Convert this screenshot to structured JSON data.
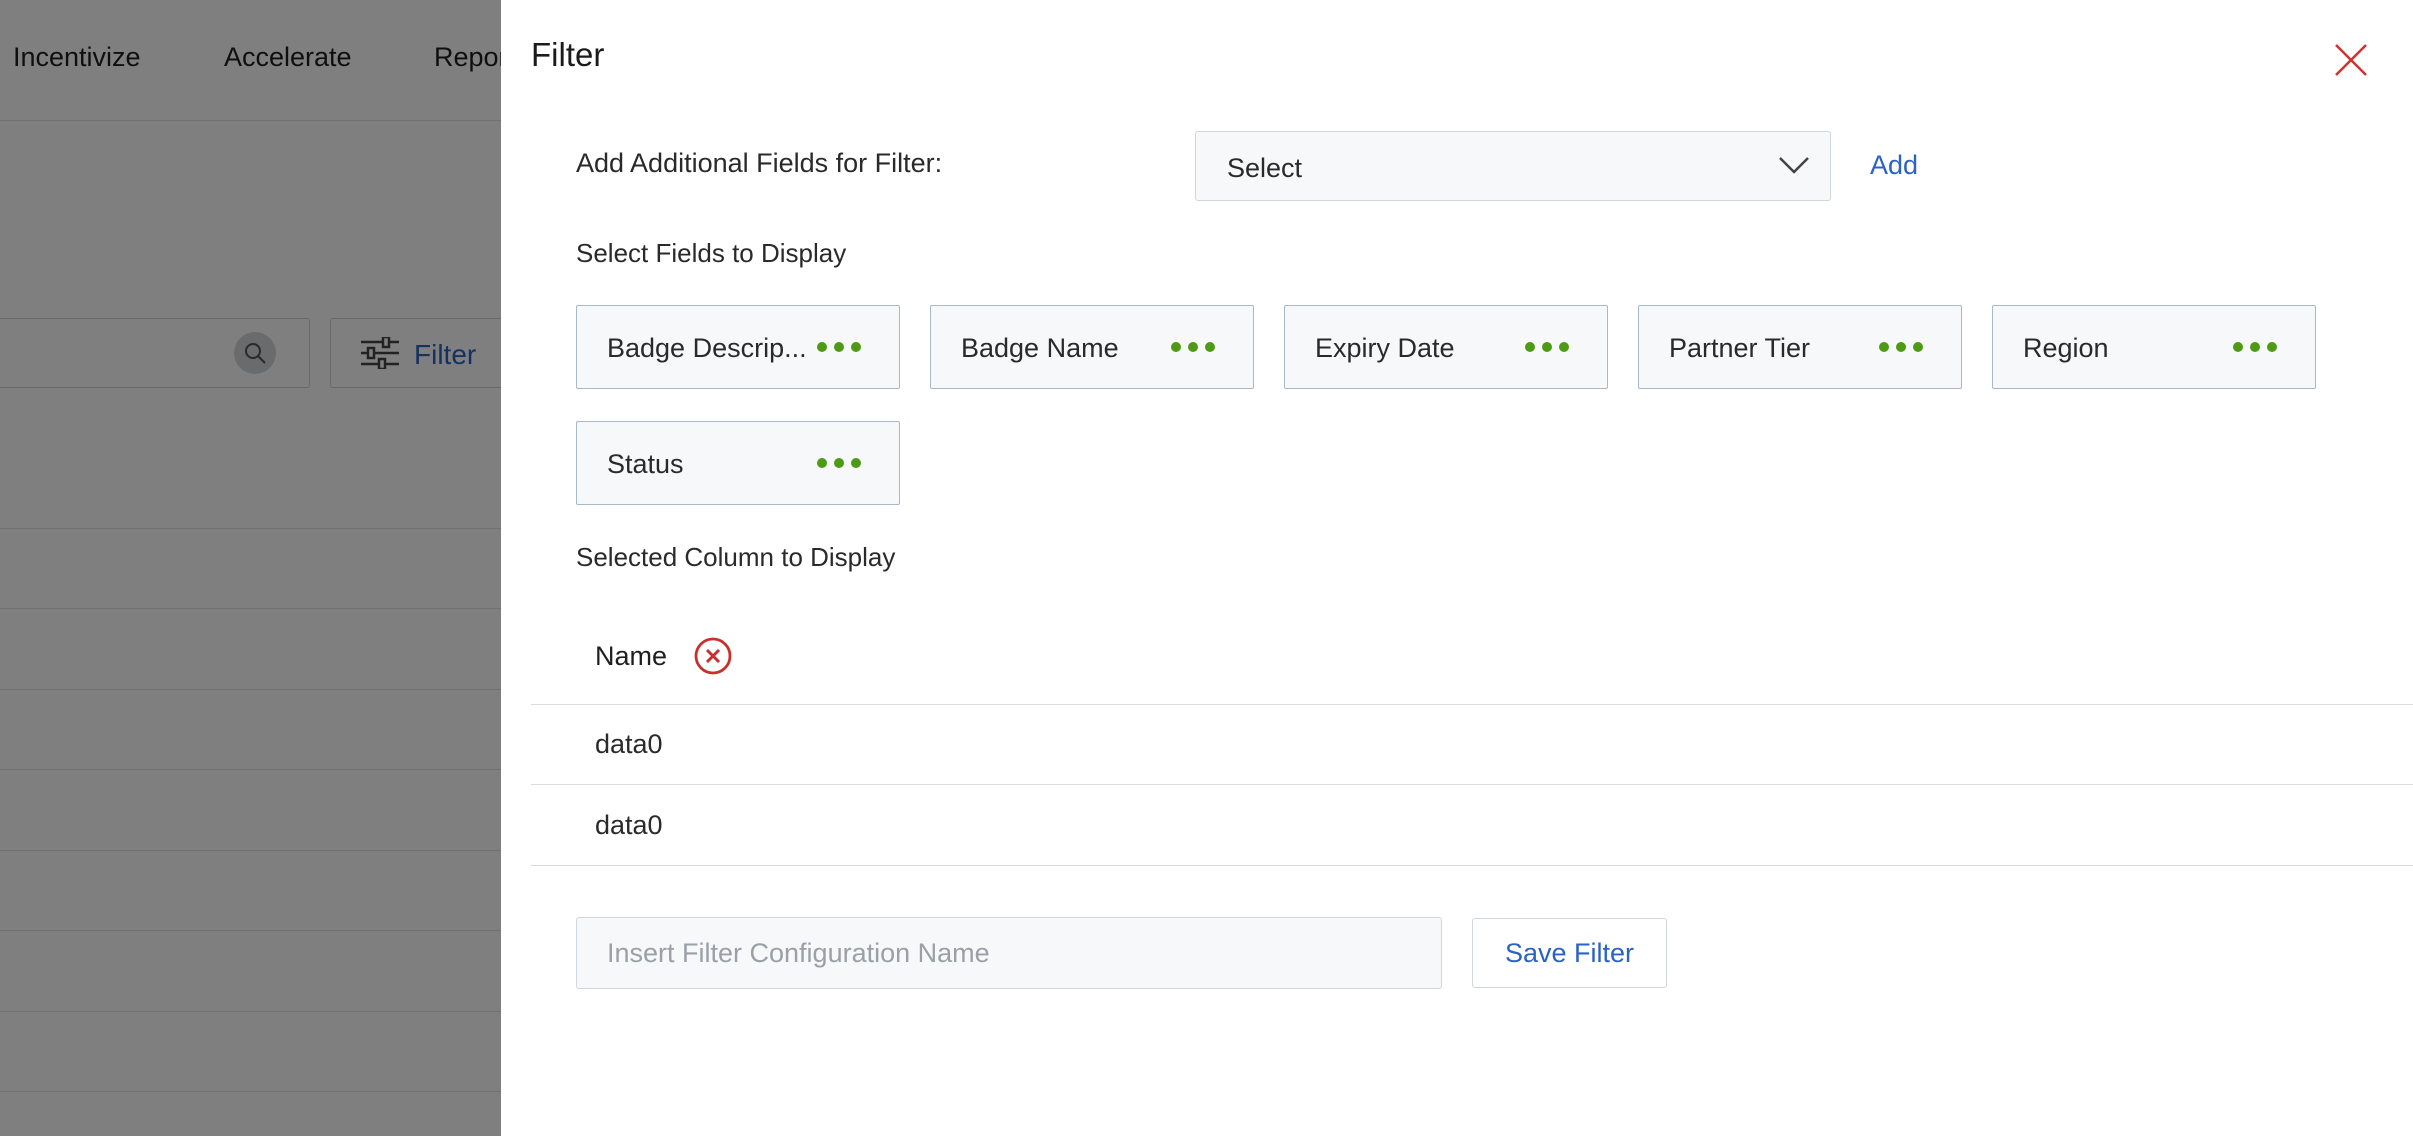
{
  "background": {
    "nav_items": [
      "Incentivize",
      "Accelerate",
      "Repor"
    ],
    "filter_button_label": "Filter"
  },
  "drawer": {
    "title": "Filter",
    "additional_fields": {
      "label": "Add Additional Fields for Filter:",
      "select_value": "Select",
      "add_label": "Add"
    },
    "fields_heading": "Select Fields to Display",
    "fields": [
      {
        "label": "Badge Descrip..."
      },
      {
        "label": "Badge Name"
      },
      {
        "label": "Expiry Date"
      },
      {
        "label": "Partner Tier"
      },
      {
        "label": "Region"
      },
      {
        "label": "Status"
      }
    ],
    "selected_heading": "Selected Column to Display",
    "table": {
      "column": "Name",
      "rows": [
        "data0",
        "data0"
      ]
    },
    "config_input_placeholder": "Insert Filter Configuration Name",
    "save_label": "Save Filter"
  },
  "colors": {
    "accent": "#2b63c4",
    "dots": "#4f9a14",
    "close": "#d0312d"
  }
}
